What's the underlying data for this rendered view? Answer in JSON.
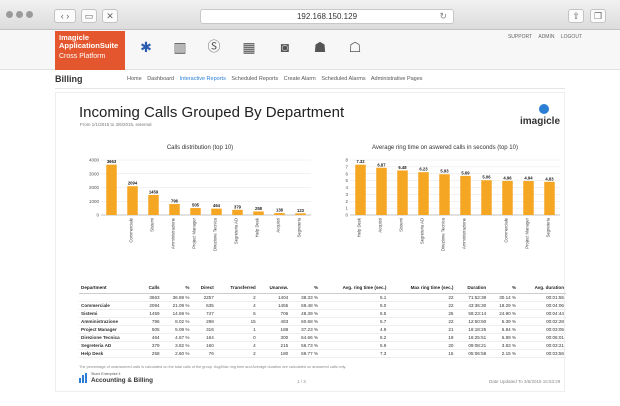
{
  "browser": {
    "url": "192.168.150.129",
    "reload_icon": "reload-icon",
    "share_icon": "share-icon",
    "tabs_icon": "tabs-icon"
  },
  "app": {
    "brand_line1": "Imagicle",
    "brand_line2": "ApplicationSuite",
    "brand_line3": "Cross Platform",
    "top_links": [
      "SUPPORT",
      "ADMIN",
      "LOGOUT"
    ],
    "nav_icons": [
      "gear-icon",
      "bar-chart-icon",
      "dollar-icon",
      "fax-icon",
      "contacts-icon",
      "users-icon",
      "money-person-icon"
    ],
    "accent": "#e4572e"
  },
  "section": {
    "title": "Billing",
    "menu": [
      "Home",
      "Dashboard",
      "Interactive Reports",
      "Scheduled Reports",
      "Create Alarm",
      "Scheduled Alarms",
      "Administrative Pages"
    ],
    "active_menu": "Interactive Reports"
  },
  "report": {
    "title": "Incoming Calls Grouped By Department",
    "subtitle": "From 1/1/2015 to 3/6/2015, external",
    "logo_text": "imagicle",
    "footnote": "The percentage of unanswered calls is calculated on the total calls of the group. Avg/Max ring time and Average duration are calculated on answered calls only.",
    "footer_small": "Stumi Enterprise 4",
    "footer_big": "Accounting & Billing",
    "page_number": "1 / 3",
    "date_updated": "Date Updated To 3/6/2015 15:53:29"
  },
  "chart_data": [
    {
      "type": "bar",
      "title": "Calls distribution (top 10)",
      "categories": [
        "Commerciale",
        "Sistemi",
        "Amministrazione",
        "Project Manager",
        "Direzione Tecnica",
        "Segreteria AD",
        "Help Desk",
        "Acquisti",
        "Segreteria"
      ],
      "values": [
        3663,
        2094,
        1459,
        796,
        505,
        464,
        379,
        258,
        138,
        123
      ],
      "categories_full": [
        "",
        "Commerciale",
        "Sistemi",
        "Amministrazione",
        "Project Manager",
        "Direzione Tecnica",
        "Segreteria AD",
        "Help Desk",
        "Acquisti",
        "Segreteria"
      ],
      "ylim": [
        0,
        4000
      ],
      "yticks": [
        0,
        1000,
        2000,
        3000,
        4000
      ],
      "color": "#f5a623"
    },
    {
      "type": "bar",
      "title": "Average ring time on aswered calls in seconds (top 10)",
      "categories": [
        "Help Desk",
        "Acquisti",
        "Sistemi",
        "Segreteria AD",
        "Direzione Tecnica",
        "Amministrazione",
        "",
        "Commerciale",
        "Project Manager",
        "Segreteria"
      ],
      "values": [
        7.32,
        6.87,
        6.48,
        6.23,
        5.93,
        5.69,
        5.06,
        4.96,
        4.94,
        4.83
      ],
      "ylim": [
        0,
        8
      ],
      "yticks": [
        0,
        1,
        2,
        3,
        4,
        5,
        6,
        7,
        8
      ],
      "color": "#f5a623"
    }
  ],
  "table": {
    "headers": [
      "Department",
      "Calls",
      "%",
      "Direct",
      "Transferred",
      "Unansw.",
      "%",
      "Avg. ring time (sec.)",
      "Max ring time (sec.)",
      "Duration",
      "%",
      "Avg. duration"
    ],
    "rows": [
      [
        "",
        "3663",
        "36.89 %",
        "2257",
        "2",
        "1404",
        "38.33 %",
        "5.1",
        "22",
        "71:52:39",
        "30.14 %",
        "00:01:55"
      ],
      [
        "Commerciale",
        "2094",
        "21.09 %",
        "635",
        "4",
        "1455",
        "69.48 %",
        "5.0",
        "22",
        "43:36:30",
        "18.29 %",
        "00:04:06"
      ],
      [
        "Sistemi",
        "1459",
        "14.69 %",
        "747",
        "6",
        "706",
        "48.39 %",
        "6.5",
        "25",
        "59:23:14",
        "24.90 %",
        "00:04:44"
      ],
      [
        "Amministrazione",
        "796",
        "8.02 %",
        "298",
        "15",
        "483",
        "60.68 %",
        "5.7",
        "22",
        "12:50:50",
        "5.39 %",
        "00:02:28"
      ],
      [
        "Project Manager",
        "505",
        "5.09 %",
        "316",
        "1",
        "188",
        "37.23 %",
        "4.9",
        "21",
        "16:18:25",
        "6.84 %",
        "00:03:05"
      ],
      [
        "Direzione Tecnica",
        "464",
        "4.67 %",
        "164",
        "0",
        "300",
        "64.66 %",
        "6.2",
        "19",
        "16:25:51",
        "6.89 %",
        "00:06:01"
      ],
      [
        "Segreteria AD",
        "379",
        "3.82 %",
        "160",
        "4",
        "215",
        "56.73 %",
        "5.9",
        "20",
        "09:08:21",
        "3.83 %",
        "00:03:21"
      ],
      [
        "Help Desk",
        "258",
        "2.60 %",
        "76",
        "2",
        "180",
        "69.77 %",
        "7.3",
        "15",
        "05:06:58",
        "2.15 %",
        "00:03:56"
      ]
    ]
  }
}
